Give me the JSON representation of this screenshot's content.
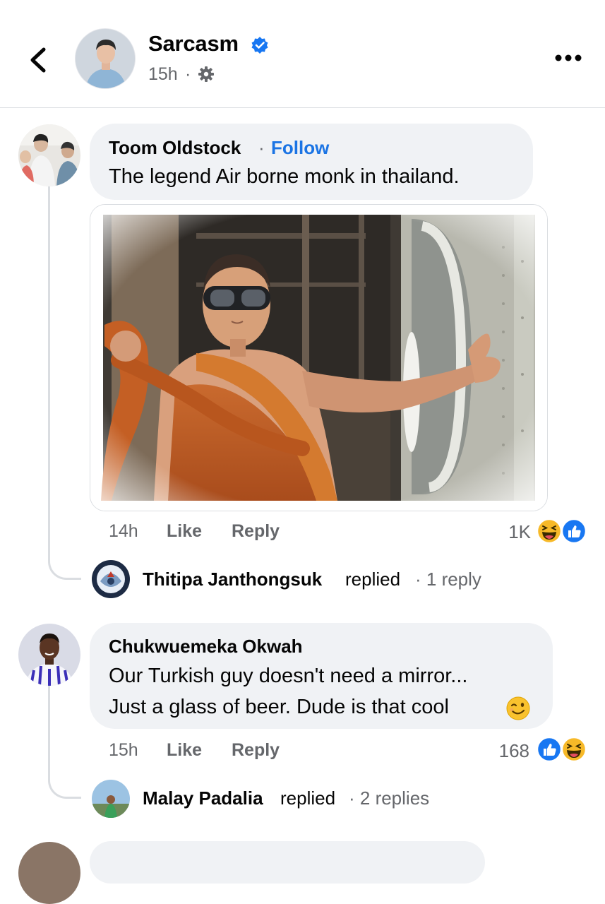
{
  "header": {
    "page_name": "Sarcasm",
    "time": "15h",
    "separator": "·"
  },
  "comments": [
    {
      "author": "Toom Oldstock",
      "follow_label": "Follow",
      "separator": "·",
      "text": "The legend Air borne monk in thailand.",
      "time": "14h",
      "like_label": "Like",
      "reply_label": "Reply",
      "reaction_count": "1K",
      "reply_preview": {
        "name": "Thitipa Janthongsuk",
        "verb": "replied",
        "count": "· 1 reply"
      }
    },
    {
      "author": "Chukwuemeka Okwah",
      "text_line1": "Our Turkish guy doesn't need a mirror...",
      "text_line2": "Just a glass of beer. Dude is that cool",
      "time": "15h",
      "like_label": "Like",
      "reply_label": "Reply",
      "reaction_count": "168",
      "reply_preview": {
        "name": "Malay Padalia",
        "verb": "replied",
        "count": "· 2 replies"
      }
    }
  ],
  "icons": {
    "back": "chevron-left-icon",
    "verified": "verified-badge-icon",
    "privacy": "gear-icon",
    "more": "more-dots-icon",
    "emoji": "wink-emoji-icon",
    "reactions": [
      "haha-reaction-icon",
      "like-reaction-icon"
    ]
  },
  "colors": {
    "accent": "#1b74e4",
    "bubble": "#f0f2f5",
    "secondary_text": "#65676b",
    "like_blue": "#1877f2",
    "haha_yellow": "#f7b928"
  }
}
